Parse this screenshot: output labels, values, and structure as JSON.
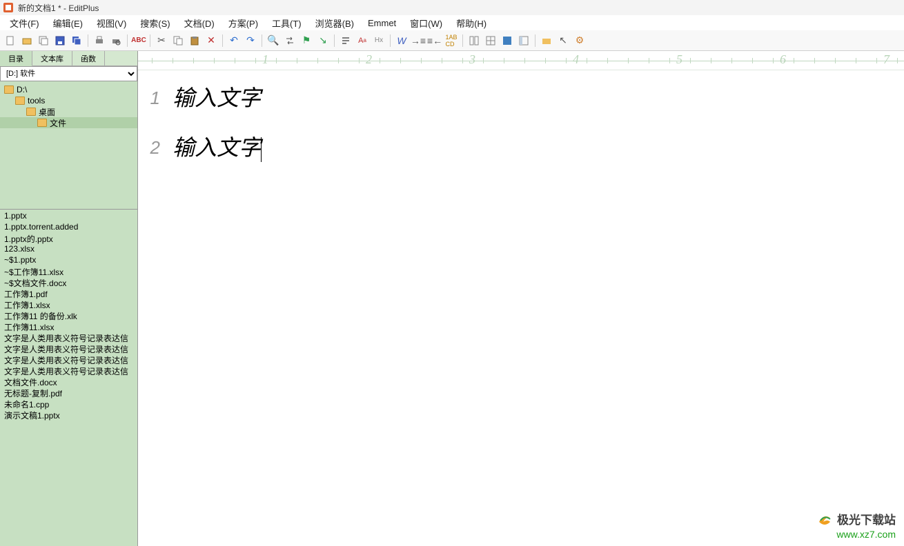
{
  "window": {
    "title": "新的文档1 * - EditPlus"
  },
  "menu": {
    "file": "文件(F)",
    "edit": "编辑(E)",
    "view": "视图(V)",
    "search": "搜索(S)",
    "document": "文档(D)",
    "project": "方案(P)",
    "tools": "工具(T)",
    "browser": "浏览器(B)",
    "emmet": "Emmet",
    "window": "窗口(W)",
    "help": "帮助(H)"
  },
  "sidebar": {
    "tabs": [
      "目录",
      "文本库",
      "函数"
    ],
    "drive_label": "[D:] 软件",
    "folders": [
      {
        "name": "D:\\",
        "depth": 0
      },
      {
        "name": "tools",
        "depth": 1
      },
      {
        "name": "桌面",
        "depth": 2
      },
      {
        "name": "文件",
        "depth": 3,
        "selected": true
      }
    ],
    "files": [
      "1.pptx",
      "1.pptx.torrent.added",
      "1.pptx的.pptx",
      "123.xlsx",
      "~$1.pptx",
      "~$工作簿11.xlsx",
      "~$文档文件.docx",
      "工作簿1.pdf",
      "工作簿1.xlsx",
      "工作簿11 的备份.xlk",
      "工作簿11.xlsx",
      "文字是人类用表义符号记录表达信",
      "文字是人类用表义符号记录表达信",
      "文字是人类用表义符号记录表达信",
      "文字是人类用表义符号记录表达信",
      "文档文件.docx",
      "无标题-复制.pdf",
      "未命名1.cpp",
      "演示文稿1.pptx"
    ]
  },
  "ruler_marks": [
    "1",
    "2",
    "3",
    "4",
    "5",
    "6",
    "7"
  ],
  "editor": {
    "lines": [
      "输入文字",
      "输入文字"
    ]
  },
  "watermark": {
    "title": "极光下载站",
    "site": "www.xz7.com"
  }
}
